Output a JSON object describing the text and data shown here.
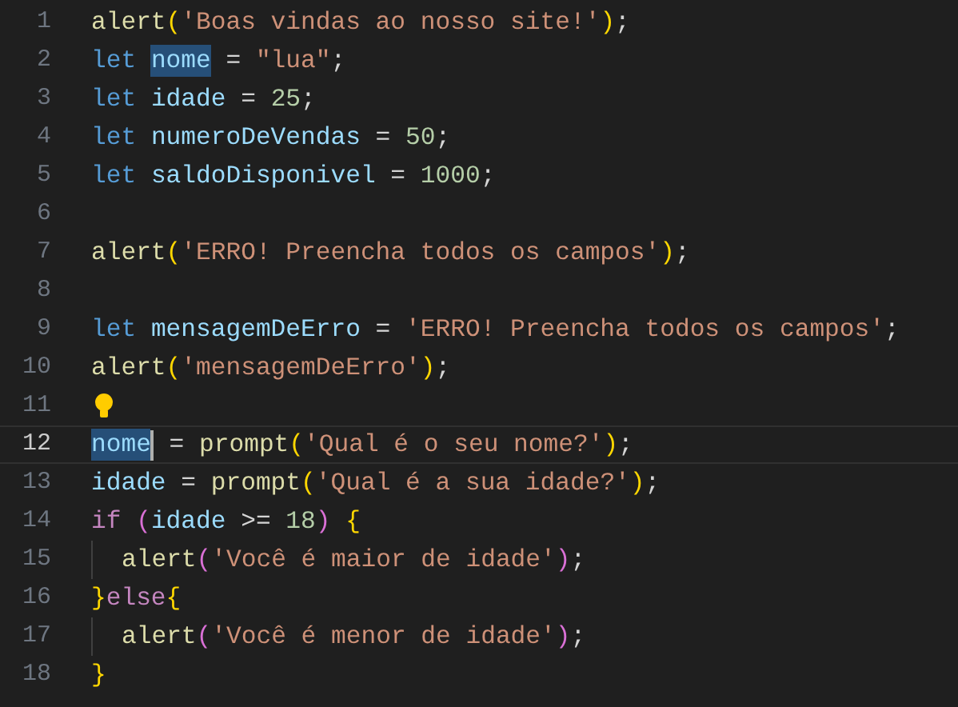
{
  "lines": [
    {
      "number": "1",
      "current": false,
      "guide": false,
      "bulb": false,
      "tokens": [
        {
          "text": "alert",
          "kind": "fn"
        },
        {
          "text": "(",
          "kind": "br"
        },
        {
          "text": "'Boas vindas ao nosso site!'",
          "kind": "str"
        },
        {
          "text": ")",
          "kind": "br"
        },
        {
          "text": ";",
          "kind": "op"
        }
      ]
    },
    {
      "number": "2",
      "current": false,
      "guide": false,
      "bulb": false,
      "tokens": [
        {
          "text": "let ",
          "kind": "kw"
        },
        {
          "text": "nome",
          "kind": "match"
        },
        {
          "text": " = ",
          "kind": "op"
        },
        {
          "text": "\"lua\"",
          "kind": "str"
        },
        {
          "text": ";",
          "kind": "op"
        }
      ]
    },
    {
      "number": "3",
      "current": false,
      "guide": false,
      "bulb": false,
      "tokens": [
        {
          "text": "let ",
          "kind": "kw"
        },
        {
          "text": "idade",
          "kind": "var"
        },
        {
          "text": " = ",
          "kind": "op"
        },
        {
          "text": "25",
          "kind": "num"
        },
        {
          "text": ";",
          "kind": "op"
        }
      ]
    },
    {
      "number": "4",
      "current": false,
      "guide": false,
      "bulb": false,
      "tokens": [
        {
          "text": "let ",
          "kind": "kw"
        },
        {
          "text": "numeroDeVendas",
          "kind": "var"
        },
        {
          "text": " = ",
          "kind": "op"
        },
        {
          "text": "50",
          "kind": "num"
        },
        {
          "text": ";",
          "kind": "op"
        }
      ]
    },
    {
      "number": "5",
      "current": false,
      "guide": false,
      "bulb": false,
      "tokens": [
        {
          "text": "let ",
          "kind": "kw"
        },
        {
          "text": "saldoDisponivel",
          "kind": "var"
        },
        {
          "text": " = ",
          "kind": "op"
        },
        {
          "text": "1000",
          "kind": "num"
        },
        {
          "text": ";",
          "kind": "op"
        }
      ]
    },
    {
      "number": "6",
      "current": false,
      "guide": false,
      "bulb": false
    },
    {
      "number": "7",
      "current": false,
      "guide": false,
      "bulb": false,
      "tokens": [
        {
          "text": "alert",
          "kind": "fn"
        },
        {
          "text": "(",
          "kind": "br"
        },
        {
          "text": "'ERRO! Preencha todos os campos'",
          "kind": "str"
        },
        {
          "text": ")",
          "kind": "br"
        },
        {
          "text": ";",
          "kind": "op"
        }
      ]
    },
    {
      "number": "8",
      "current": false,
      "guide": false,
      "bulb": false
    },
    {
      "number": "9",
      "current": false,
      "guide": false,
      "bulb": false,
      "tokens": [
        {
          "text": "let ",
          "kind": "kw"
        },
        {
          "text": "mensagemDeErro",
          "kind": "var"
        },
        {
          "text": " = ",
          "kind": "op"
        },
        {
          "text": "'ERRO! Preencha todos os campos'",
          "kind": "str"
        },
        {
          "text": ";",
          "kind": "op"
        }
      ]
    },
    {
      "number": "10",
      "current": false,
      "guide": false,
      "bulb": false,
      "tokens": [
        {
          "text": "alert",
          "kind": "fn"
        },
        {
          "text": "(",
          "kind": "br"
        },
        {
          "text": "'mensagemDeErro'",
          "kind": "str"
        },
        {
          "text": ")",
          "kind": "br"
        },
        {
          "text": ";",
          "kind": "op"
        }
      ]
    },
    {
      "number": "11",
      "current": false,
      "guide": false,
      "bulb": true
    },
    {
      "number": "12",
      "current": true,
      "guide": false,
      "bulb": false,
      "tokens": [
        {
          "text": "nome",
          "kind": "match"
        },
        {
          "kind": "cursor"
        },
        {
          "text": " = ",
          "kind": "op"
        },
        {
          "text": "prompt",
          "kind": "fn"
        },
        {
          "text": "(",
          "kind": "br"
        },
        {
          "text": "'Qual é o seu nome?'",
          "kind": "str"
        },
        {
          "text": ")",
          "kind": "br"
        },
        {
          "text": ";",
          "kind": "op"
        }
      ]
    },
    {
      "number": "13",
      "current": false,
      "guide": false,
      "bulb": false,
      "tokens": [
        {
          "text": "idade",
          "kind": "var"
        },
        {
          "text": " = ",
          "kind": "op"
        },
        {
          "text": "prompt",
          "kind": "fn"
        },
        {
          "text": "(",
          "kind": "br"
        },
        {
          "text": "'Qual é a sua idade?'",
          "kind": "str"
        },
        {
          "text": ")",
          "kind": "br"
        },
        {
          "text": ";",
          "kind": "op"
        }
      ]
    },
    {
      "number": "14",
      "current": false,
      "guide": false,
      "bulb": false,
      "tokens": [
        {
          "text": "if ",
          "kind": "ctl"
        },
        {
          "text": "(",
          "kind": "br2"
        },
        {
          "text": "idade",
          "kind": "var"
        },
        {
          "text": " >= ",
          "kind": "op"
        },
        {
          "text": "18",
          "kind": "num"
        },
        {
          "text": ")",
          "kind": "br2"
        },
        {
          "text": " {",
          "kind": "br"
        }
      ]
    },
    {
      "number": "15",
      "current": false,
      "guide": true,
      "bulb": false,
      "tokens": [
        {
          "text": "alert",
          "kind": "fn"
        },
        {
          "text": "(",
          "kind": "br2"
        },
        {
          "text": "'Você é maior de idade'",
          "kind": "str"
        },
        {
          "text": ")",
          "kind": "br2"
        },
        {
          "text": ";",
          "kind": "op"
        }
      ]
    },
    {
      "number": "16",
      "current": false,
      "guide": false,
      "bulb": false,
      "tokens": [
        {
          "text": "}",
          "kind": "br"
        },
        {
          "text": "else",
          "kind": "ctl"
        },
        {
          "text": "{",
          "kind": "br"
        }
      ]
    },
    {
      "number": "17",
      "current": false,
      "guide": true,
      "bulb": false,
      "tokens": [
        {
          "text": "alert",
          "kind": "fn"
        },
        {
          "text": "(",
          "kind": "br2"
        },
        {
          "text": "'Você é menor de idade'",
          "kind": "str"
        },
        {
          "text": ")",
          "kind": "br2"
        },
        {
          "text": ";",
          "kind": "op"
        }
      ]
    },
    {
      "number": "18",
      "current": false,
      "guide": false,
      "bulb": false,
      "tokens": [
        {
          "text": "}",
          "kind": "br"
        }
      ]
    }
  ]
}
